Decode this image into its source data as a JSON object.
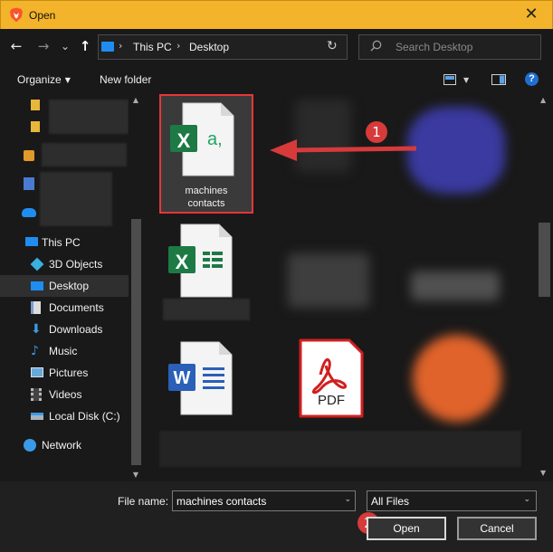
{
  "window": {
    "title": "Open",
    "close_glyph": "✕",
    "accent": "#f3b42b"
  },
  "nav": {
    "back_glyph": "←",
    "forward_glyph": "→",
    "recent_glyph": "⌄",
    "up_glyph": "↑",
    "breadcrumb": [
      "This PC",
      "Desktop"
    ],
    "refresh_glyph": "↻",
    "search_placeholder": "Search Desktop"
  },
  "toolbar": {
    "organize_label": "Organize",
    "new_folder_label": "New folder",
    "help_glyph": "?"
  },
  "sidebar": {
    "items": [
      {
        "label": "This PC",
        "icon": "this-pc-icon"
      },
      {
        "label": "3D Objects",
        "icon": "3d-objects-icon"
      },
      {
        "label": "Desktop",
        "icon": "desktop-icon",
        "selected": true
      },
      {
        "label": "Documents",
        "icon": "documents-icon"
      },
      {
        "label": "Downloads",
        "icon": "downloads-icon"
      },
      {
        "label": "Music",
        "icon": "music-icon"
      },
      {
        "label": "Pictures",
        "icon": "pictures-icon"
      },
      {
        "label": "Videos",
        "icon": "videos-icon"
      },
      {
        "label": "Local Disk (C:)",
        "icon": "local-disk-icon"
      },
      {
        "label": "Network",
        "icon": "network-icon"
      }
    ]
  },
  "files": {
    "selected_file": {
      "name_line1": "machines",
      "name_line2": "contacts",
      "type": "excel-csv"
    },
    "excel_badge": "X",
    "csv_glyph": "a,",
    "word_badge": "W",
    "pdf_label": "PDF"
  },
  "bottom": {
    "file_name_label": "File name:",
    "file_name_value": "machines contacts",
    "file_type_value": "All Files",
    "open_label": "Open",
    "cancel_label": "Cancel"
  },
  "callouts": {
    "first": "1",
    "second": "2",
    "color": "#d63a3a"
  }
}
